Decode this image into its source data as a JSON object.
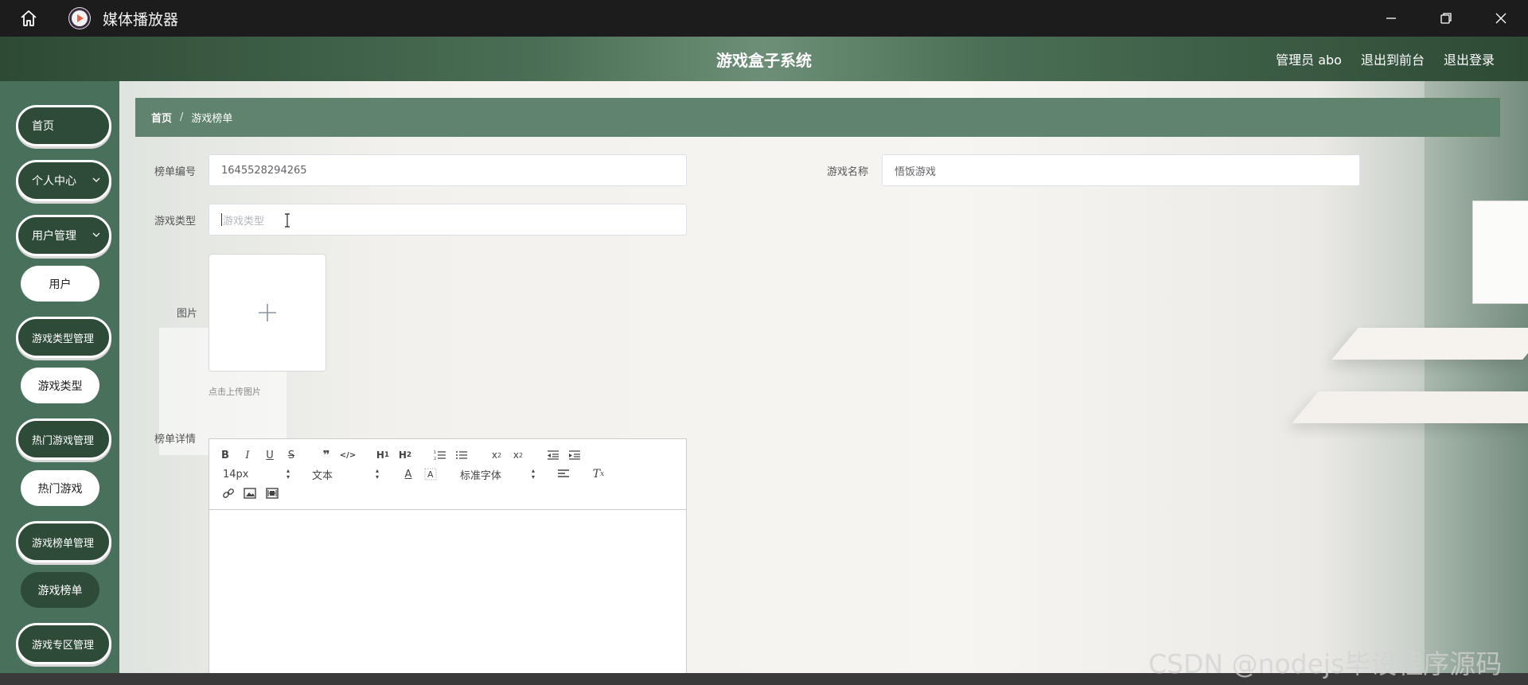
{
  "titlebar": {
    "title": "媒体播放器",
    "icons": [
      "home-icon",
      "media-player-icon",
      "minimize-icon",
      "restore-icon",
      "close-icon"
    ]
  },
  "header": {
    "title": "游戏盒子系统",
    "admin": "管理员 abo",
    "back_frontend": "退出到前台",
    "logout": "退出登录"
  },
  "sidebar": {
    "items": [
      {
        "label": "首页"
      },
      {
        "label": "个人中心"
      },
      {
        "label": "用户管理"
      },
      {
        "label": "用户"
      },
      {
        "label": "游戏类型管理"
      },
      {
        "label": "游戏类型"
      },
      {
        "label": "热门游戏管理"
      },
      {
        "label": "热门游戏"
      },
      {
        "label": "游戏榜单管理"
      },
      {
        "label": "游戏榜单"
      },
      {
        "label": "游戏专区管理"
      }
    ],
    "active": "游戏榜单"
  },
  "breadcrumb": {
    "home": "首页",
    "separator": "/",
    "current": "游戏榜单"
  },
  "form": {
    "list_no_label": "榜单编号",
    "list_no_value": "1645528294265",
    "game_name_label": "游戏名称",
    "game_name_value": "悟饭游戏",
    "game_type_label": "游戏类型",
    "game_type_placeholder": "游戏类型",
    "image_label": "图片",
    "upload_hint": "点击上传图片",
    "detail_label": "榜单详情"
  },
  "editor": {
    "font_size": "14px",
    "header_select": "文本",
    "font_family": "标准字体",
    "buttons": [
      "B",
      "I",
      "U",
      "S",
      "❞",
      "</>",
      "H1",
      "H2",
      "ol",
      "ul",
      "x₂",
      "x²",
      "outdent",
      "indent",
      "A",
      "A-bg",
      "align",
      "Tx",
      "link",
      "image",
      "video"
    ]
  },
  "watermark": "CSDN @nodejs毕设程序源码",
  "colors": {
    "theme_dark": "#2e4b37",
    "theme_mid": "#49705a",
    "breadcrumb_bg": "#5f836c",
    "titlebar_bg": "#1c1c1c"
  }
}
